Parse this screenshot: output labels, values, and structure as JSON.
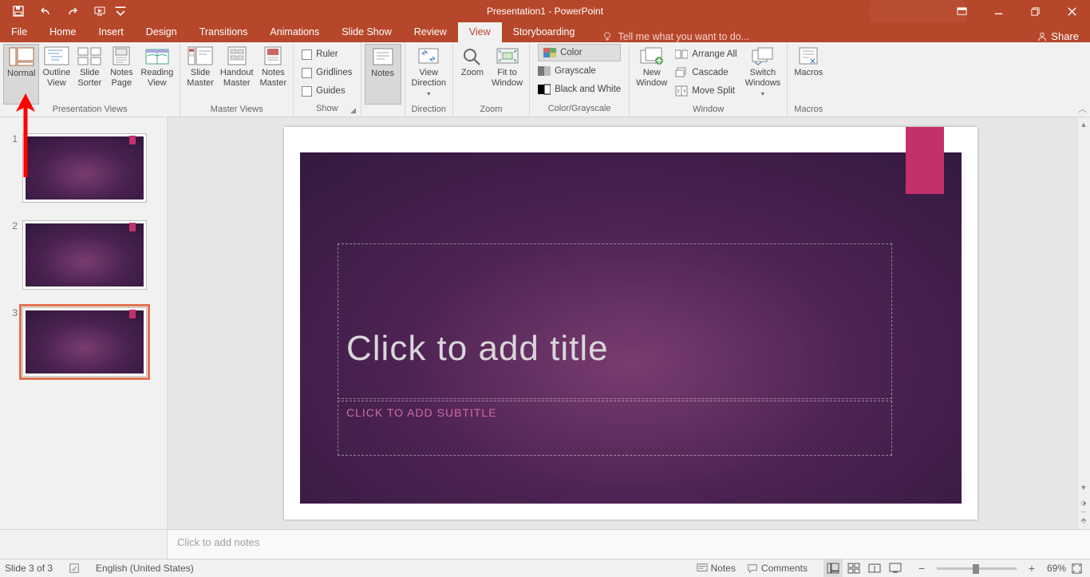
{
  "app": {
    "title": "Presentation1 - PowerPoint"
  },
  "tabs": {
    "file": "File",
    "home": "Home",
    "insert": "Insert",
    "design": "Design",
    "transitions": "Transitions",
    "animations": "Animations",
    "slideshow": "Slide Show",
    "review": "Review",
    "view": "View",
    "storyboarding": "Storyboarding",
    "tellme": "Tell me what you want to do...",
    "share": "Share"
  },
  "ribbon": {
    "group_presentation_views": "Presentation Views",
    "group_master_views": "Master Views",
    "group_show": "Show",
    "group_notes": "",
    "group_direction": "Direction",
    "group_zoom": "Zoom",
    "group_color": "Color/Grayscale",
    "group_window": "Window",
    "group_macros": "Macros",
    "normal": "Normal",
    "outline": "Outline\nView",
    "sorter": "Slide\nSorter",
    "notespage": "Notes\nPage",
    "reading": "Reading\nView",
    "slidemaster": "Slide\nMaster",
    "handoutmaster": "Handout\nMaster",
    "notesmaster": "Notes\nMaster",
    "ruler": "Ruler",
    "gridlines": "Gridlines",
    "guides": "Guides",
    "notes": "Notes",
    "viewdir": "View\nDirection",
    "zoom": "Zoom",
    "fit": "Fit to\nWindow",
    "color": "Color",
    "grayscale": "Grayscale",
    "bw": "Black and White",
    "newwindow": "New\nWindow",
    "arrange": "Arrange All",
    "cascade": "Cascade",
    "movesplit": "Move Split",
    "switch": "Switch\nWindows",
    "macros": "Macros"
  },
  "slides": {
    "numbers": [
      "1",
      "2",
      "3"
    ],
    "title_placeholder": "Click to add title",
    "subtitle_placeholder": "CLICK TO ADD SUBTITLE"
  },
  "notes_placeholder": "Click to add notes",
  "status": {
    "slide": "Slide 3 of 3",
    "lang": "English (United States)",
    "notes": "Notes",
    "comments": "Comments",
    "zoom": "69%"
  }
}
